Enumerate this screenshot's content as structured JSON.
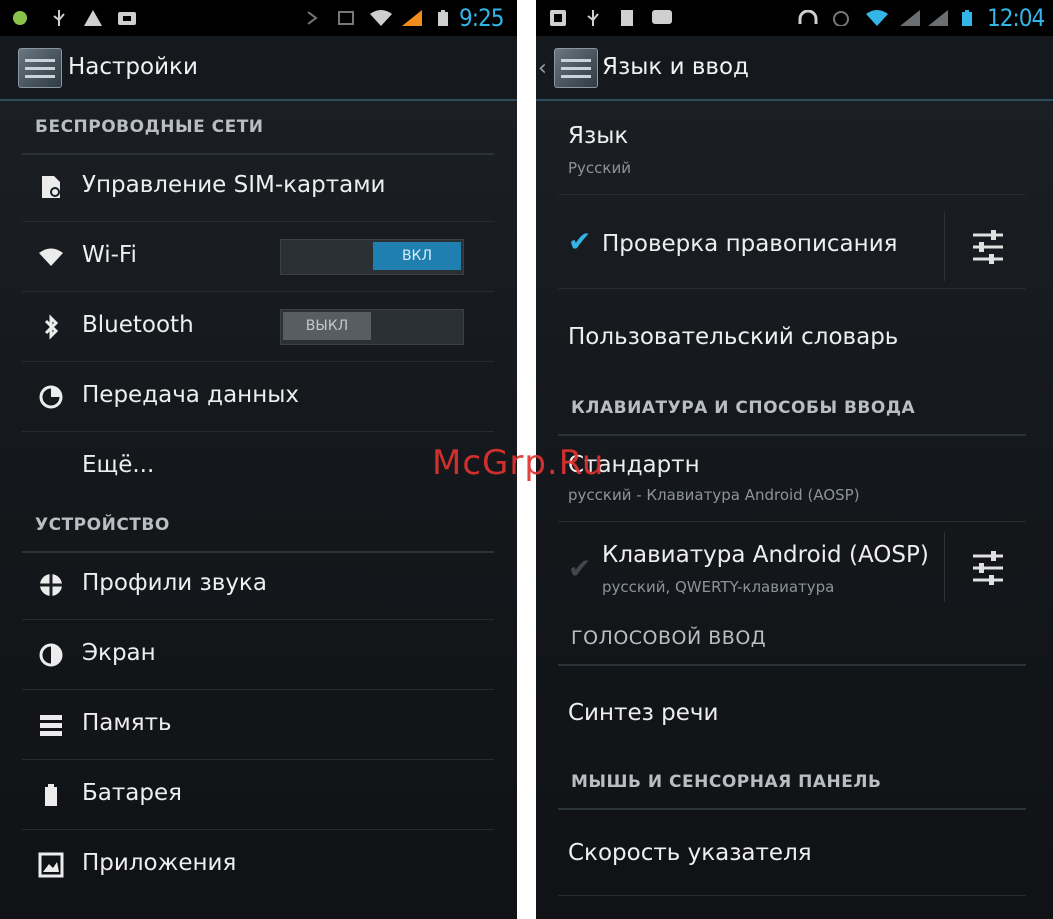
{
  "left": {
    "status": {
      "time": "9:25"
    },
    "title": "Настройки",
    "sections": {
      "wireless": "БЕСПРОВОДНЫЕ СЕТИ",
      "device": "УСТРОЙСТВО"
    },
    "items": {
      "sim": "Управление SIM-картами",
      "wifi": "Wi-Fi",
      "wifi_toggle": "ВКЛ",
      "bluetooth": "Bluetooth",
      "bluetooth_toggle": "ВЫКЛ",
      "data": "Передача данных",
      "more": "Ещё...",
      "sound": "Профили звука",
      "screen": "Экран",
      "memory": "Память",
      "battery": "Батарея",
      "apps": "Приложения"
    },
    "icons": [
      "sim-card-icon",
      "wifi-icon",
      "bluetooth-icon",
      "data-usage-icon",
      "sound-profile-icon",
      "display-icon",
      "storage-icon",
      "battery-icon",
      "apps-icon"
    ]
  },
  "right": {
    "status": {
      "time": "12:04"
    },
    "title": "Язык и ввод",
    "language": {
      "label": "Язык",
      "value": "Русский"
    },
    "spellcheck": {
      "label": "Проверка правописания",
      "checked": true
    },
    "dictionary": "Пользовательский словарь",
    "sections": {
      "keyboard": "КЛАВИАТУРА И СПОСОБЫ ВВОДА",
      "voice": "ГОЛОСОВОЙ ВВОД",
      "mouse": "МЫШЬ И СЕНСОРНАЯ ПАНЕЛЬ"
    },
    "default_ime": {
      "label": "Стандартн",
      "value": "русский - Клавиатура Android (AOSP)"
    },
    "aosp_keyboard": {
      "label": "Клавиатура Android (AOSP)",
      "value": "русский, QWERTY-клавиатура",
      "checked": true
    },
    "tts": "Синтез речи",
    "pointer_speed": "Скорость указателя"
  },
  "watermark": "McGrp.Ru",
  "colors": {
    "accent": "#33b5e5",
    "background": "#15181c",
    "watermark": "#e0322f"
  }
}
